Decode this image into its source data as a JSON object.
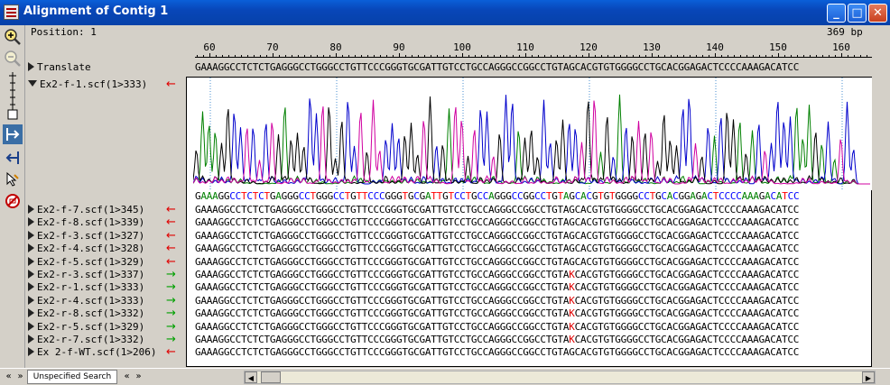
{
  "window": {
    "title": "Alignment of Contig 1"
  },
  "header": {
    "position": "Position: 1",
    "length": "369 bp"
  },
  "ruler": {
    "labels": [
      "60",
      "70",
      "80",
      "90",
      "100",
      "110",
      "120",
      "130",
      "140",
      "150",
      "160"
    ]
  },
  "translate": {
    "label": "Translate",
    "sequence": "GAAAGGCCTCTCTGAGGGCCTGGGCCTGTTCCCGGGTGCGATTGTCCTGCCAGGGCCGGCCTGTAGCACGTGTGGGGCCTGCACGGAGACTCCCCAAAGACATCC"
  },
  "expanded_read": {
    "label": "Ex2-f-1.scf(1>333)",
    "direction": "reverse",
    "called_bases": "GAAAGGCCTCTCTGAGGGCCTGGGCCTGTTCCCGGGTGCGATTGTCCTGCCAGGGCCGGCCTGTAGCACGTGTGGGGCCTGCACGGAGACTCCCCAAAGACATCC",
    "base_colors": {
      "A": "#008000",
      "C": "#0000ff",
      "G": "#000000",
      "T": "#ff0000"
    }
  },
  "reads": [
    {
      "label": "Ex2-f-7.scf(1>345)",
      "direction": "reverse",
      "pre": "GAAAGGCCTCTCTGAGGGCCTGGGCCTGTTCCCGGGTGCGATTGTCCTGCCAGGGCCGGCCTGTA",
      "mut": "G",
      "post": "CACGTGTGGGGCCTGCACGGAGACTCCCCAAAGACATCC"
    },
    {
      "label": "Ex2-f-8.scf(1>339)",
      "direction": "reverse",
      "pre": "GAAAGGCCTCTCTGAGGGCCTGGGCCTGTTCCCGGGTGCGATTGTCCTGCCAGGGCCGGCCTGTA",
      "mut": "G",
      "post": "CACGTGTGGGGCCTGCACGGAGACTCCCCAAAGACATCC"
    },
    {
      "label": "Ex2-f-3.scf(1>327)",
      "direction": "reverse",
      "pre": "GAAAGGCCTCTCTGAGGGCCTGGGCCTGTTCCCGGGTGCGATTGTCCTGCCAGGGCCGGCCTGTA",
      "mut": "G",
      "post": "CACGTGTGGGGCCTGCACGGAGACTCCCCAAAGACATCC"
    },
    {
      "label": "Ex2-f-4.scf(1>328)",
      "direction": "reverse",
      "pre": "GAAAGGCCTCTCTGAGGGCCTGGGCCTGTTCCCGGGTGCGATTGTCCTGCCAGGGCCGGCCTGTA",
      "mut": "G",
      "post": "CACGTGTGGGGCCTGCACGGAGACTCCCCAAAGACATCC"
    },
    {
      "label": "Ex2-f-5.scf(1>329)",
      "direction": "reverse",
      "pre": "GAAAGGCCTCTCTGAGGGCCTGGGCCTGTTCCCGGGTGCGATTGTCCTGCCAGGGCCGGCCTGTA",
      "mut": "G",
      "post": "CACGTGTGGGGCCTGCACGGAGACTCCCCAAAGACATCC"
    },
    {
      "label": "Ex2-r-3.scf(1>337)",
      "direction": "forward",
      "pre": "GAAAGGCCTCTCTGAGGGCCTGGGCCTGTTCCCGGGTGCGATTGTCCTGCCAGGGCCGGCCTGTA",
      "mut": "K",
      "post": "CACGTGTGGGGCCTGCACGGAGACTCCCCAAAGACATCC"
    },
    {
      "label": "Ex2-r-1.scf(1>333)",
      "direction": "forward",
      "pre": "GAAAGGCCTCTCTGAGGGCCTGGGCCTGTTCCCGGGTGCGATTGTCCTGCCAGGGCCGGCCTGTA",
      "mut": "K",
      "post": "CACGTGTGGGGCCTGCACGGAGACTCCCCAAAGACATCC"
    },
    {
      "label": "Ex2-r-4.scf(1>333)",
      "direction": "forward",
      "pre": "GAAAGGCCTCTCTGAGGGCCTGGGCCTGTTCCCGGGTGCGATTGTCCTGCCAGGGCCGGCCTGTA",
      "mut": "K",
      "post": "CACGTGTGGGGCCTGCACGGAGACTCCCCAAAGACATCC"
    },
    {
      "label": "Ex2-r-8.scf(1>332)",
      "direction": "forward",
      "pre": "GAAAGGCCTCTCTGAGGGCCTGGGCCTGTTCCCGGGTGCGATTGTCCTGCCAGGGCCGGCCTGTA",
      "mut": "K",
      "post": "CACGTGTGGGGCCTGCACGGAGACTCCCCAAAGACATCC"
    },
    {
      "label": "Ex2-r-5.scf(1>329)",
      "direction": "forward",
      "pre": "GAAAGGCCTCTCTGAGGGCCTGGGCCTGTTCCCGGGTGCGATTGTCCTGCCAGGGCCGGCCTGTA",
      "mut": "K",
      "post": "CACGTGTGGGGCCTGCACGGAGACTCCCCAAAGACATCC"
    },
    {
      "label": "Ex2-r-7.scf(1>332)",
      "direction": "forward",
      "pre": "GAAAGGCCTCTCTGAGGGCCTGGGCCTGTTCCCGGGTGCGATTGTCCTGCCAGGGCCGGCCTGTA",
      "mut": "K",
      "post": "CACGTGTGGGGCCTGCACGGAGACTCCCCAAAGACATCC"
    },
    {
      "label": "Ex 2-f-WT.scf(1>206)",
      "direction": "reverse",
      "pre": "GAAAGGCCTCTCTGAGGGCCTGGGCCTGTTCCCGGGTGCGATTGTCCTGCCAGGGCCGGCCTGTA",
      "mut": "G",
      "post": "CACGTGTGGGGCCTGCACGGAGACTCCCCAAAGACATCC"
    }
  ],
  "toolbar_icons": [
    "zoom-in-icon",
    "zoom-out-icon",
    "trace-height-slider-icon",
    "collapse-right-icon",
    "collapse-left-icon",
    "pointer-icon",
    "stop-icon"
  ],
  "bottom": {
    "tab": "Unspecified Search"
  }
}
